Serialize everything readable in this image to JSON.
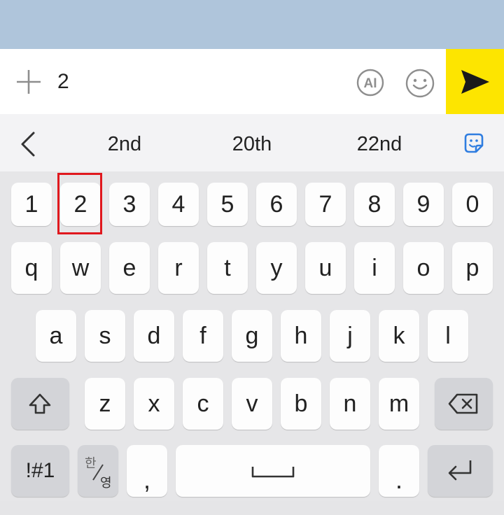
{
  "composer": {
    "typed_text": "2",
    "ai_label": "AI"
  },
  "suggestions": [
    "2nd",
    "20th",
    "22nd"
  ],
  "keyboard": {
    "row_numbers": [
      "1",
      "2",
      "3",
      "4",
      "5",
      "6",
      "7",
      "8",
      "9",
      "0"
    ],
    "row_top": [
      "q",
      "w",
      "e",
      "r",
      "t",
      "y",
      "u",
      "i",
      "o",
      "p"
    ],
    "row_home": [
      "a",
      "s",
      "d",
      "f",
      "g",
      "h",
      "j",
      "k",
      "l"
    ],
    "row_bottom": [
      "z",
      "x",
      "c",
      "v",
      "b",
      "n",
      "m"
    ],
    "symbols_label": "!#1",
    "lang_top": "한",
    "lang_bottom": "영",
    "comma": ",",
    "period": "."
  },
  "colors": {
    "top_bar": "#afc5db",
    "send_button": "#fde500",
    "highlight": "#e0181e"
  }
}
